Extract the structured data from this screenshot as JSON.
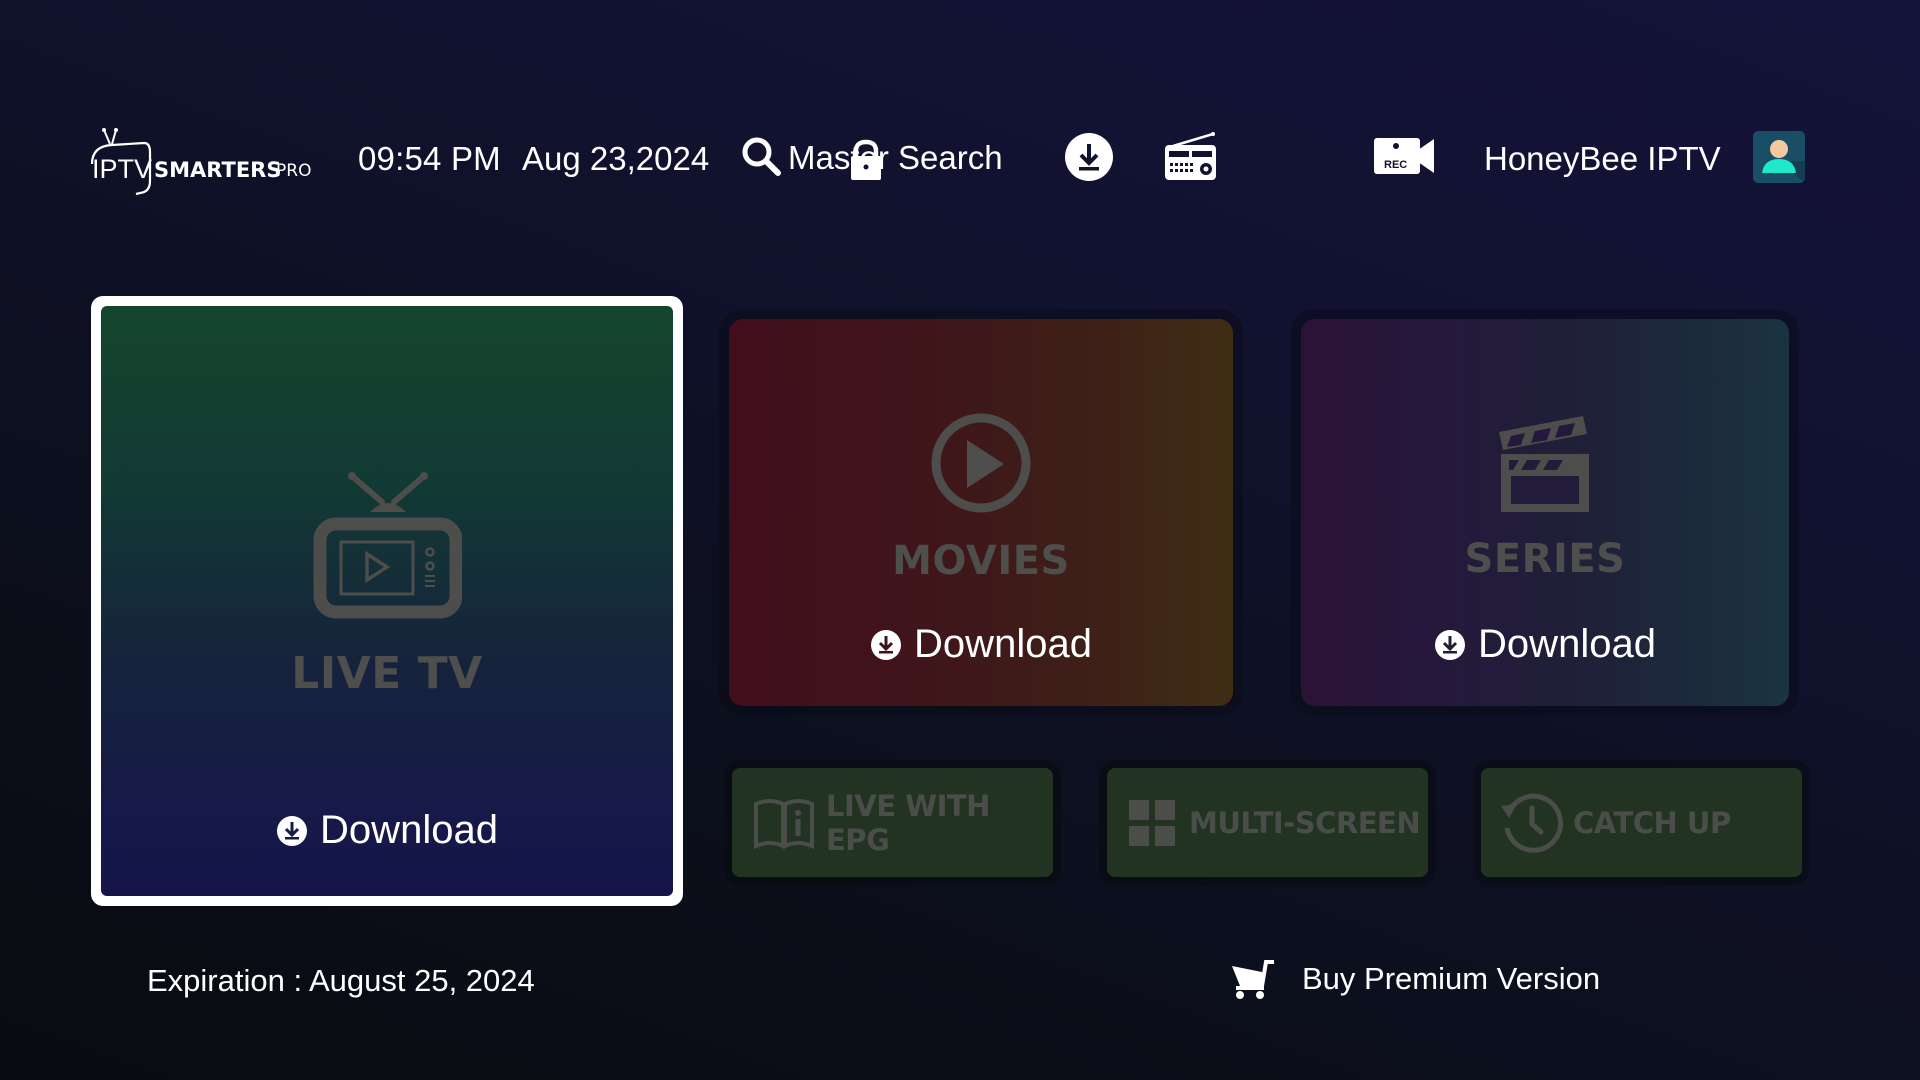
{
  "header": {
    "logo": {
      "main": "IPTV",
      "brand": "SMARTERS",
      "suffix": "PRO"
    },
    "time": "09:54 PM",
    "date": "Aug 23,2024",
    "search_label": "Master Search",
    "icons": [
      "download-icon",
      "radio-icon",
      "record-icon"
    ],
    "user_name": "HoneyBee IPTV",
    "avatar_colors": {
      "bg": "#1a4d66",
      "head": "#f5c9a0",
      "body": "#1de9c8"
    }
  },
  "cards": {
    "live_tv": {
      "title": "LIVE TV",
      "action": "Download",
      "icon": "tv-icon",
      "selected": true
    },
    "movies": {
      "title": "MOVIES",
      "action": "Download",
      "icon": "play-circle-icon"
    },
    "series": {
      "title": "SERIES",
      "action": "Download",
      "icon": "clapperboard-icon"
    }
  },
  "small_buttons": {
    "epg": {
      "line1": "LIVE WITH",
      "line2": "EPG",
      "icon": "book-info-icon"
    },
    "multi_screen": {
      "label": "MULTI-SCREEN",
      "icon": "grid-icon"
    },
    "catch_up": {
      "label": "CATCH UP",
      "icon": "history-icon"
    }
  },
  "footer": {
    "expiration": "Expiration : August 25, 2024",
    "buy_premium": "Buy Premium Version"
  }
}
